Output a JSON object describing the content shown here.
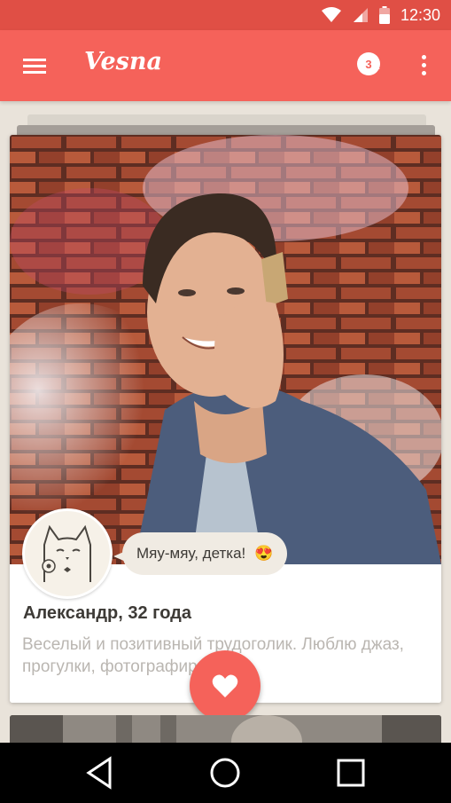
{
  "status_bar": {
    "time": "12:30",
    "icons": [
      "wifi-icon",
      "signal-icon",
      "battery-icon"
    ]
  },
  "app_bar": {
    "title": "Vesna",
    "menu_icon": "menu-icon",
    "notifications_count": "3",
    "more_icon": "more-vert-icon"
  },
  "card": {
    "name": "Александр, 32 года",
    "bio": "Веселый и позитивный трудоголик. Люблю джаз, прогулки, фотографировать.",
    "bubble_text": "Мяу-мяу, детка!",
    "bubble_emoji": "😍"
  },
  "fab": {
    "icon": "heart-icon"
  },
  "nav_bar": {
    "icons": [
      "back-icon",
      "home-icon",
      "recents-icon"
    ]
  },
  "colors": {
    "accent": "#f5625a",
    "status_bar": "#e04f45",
    "background": "#e9e3da"
  }
}
